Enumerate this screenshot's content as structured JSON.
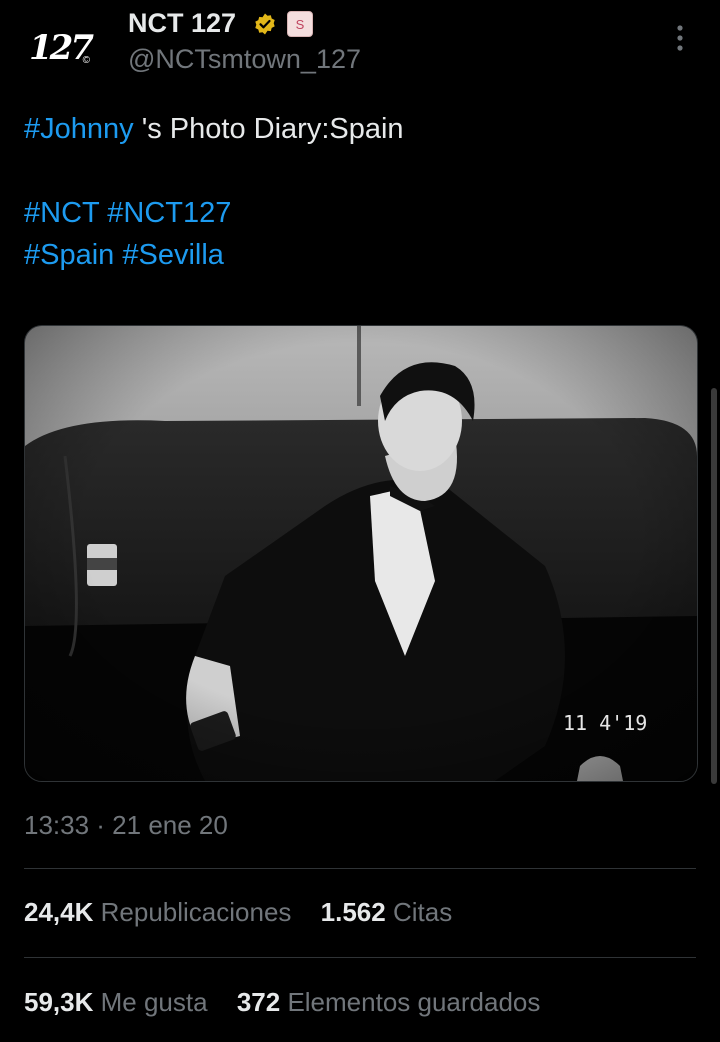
{
  "account": {
    "avatar_text": "127",
    "avatar_mark": "©",
    "display_name": "NCT 127",
    "handle": "@NCTsmtown_127",
    "affiliate_badge": "S"
  },
  "tweet": {
    "hashtag_johnny": "#Johnny",
    "line1_rest": " 's Photo Diary:Spain",
    "line2_tags": [
      "#NCT",
      "#NCT127"
    ],
    "line3_tags": [
      "#Spain",
      "#Sevilla"
    ]
  },
  "photo": {
    "date_stamp": "11  4'19"
  },
  "timestamp": "13:33 · 21 ene 20",
  "stats": {
    "reposts_count": "24,4K",
    "reposts_label": "Republicaciones",
    "quotes_count": "1.562",
    "quotes_label": "Citas",
    "likes_count": "59,3K",
    "likes_label": "Me gusta",
    "bookmarks_count": "372",
    "bookmarks_label": "Elementos guardados"
  },
  "colors": {
    "background": "#000000",
    "text": "#e7e9ea",
    "secondary": "#71767b",
    "link": "#1d9bf0",
    "verified": "#e2b719"
  },
  "icons": [
    "verified-icon",
    "more-icon"
  ]
}
